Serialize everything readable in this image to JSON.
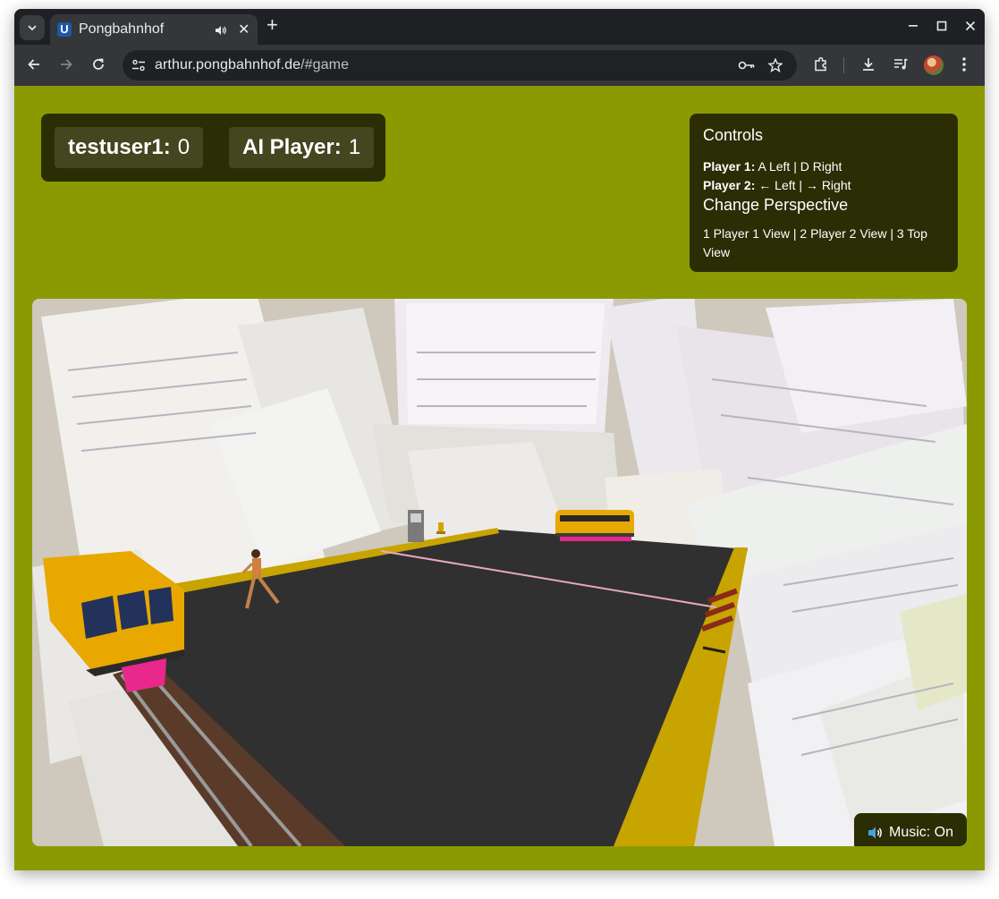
{
  "browser": {
    "tab_title": "Pongbahnhof",
    "favicon_letter": "U",
    "url_host": "arthur.pongbahnhof.de",
    "url_path": "/#game"
  },
  "scoreboard": {
    "player1_name": "testuser1:",
    "player1_score": "0",
    "player2_name": "AI Player:",
    "player2_score": "1"
  },
  "controls": {
    "title": "Controls",
    "p1_label": "Player 1:",
    "p1_keys": "A Left | D Right",
    "p2_label": "Player 2:",
    "p2_keys": "← Left | → Right",
    "perspective_title": "Change Perspective",
    "perspective_keys": "1 Player 1 View | 2 Player 2 View | 3 Top View"
  },
  "music": {
    "icon": "speaker-icon",
    "label": "Music: On"
  },
  "colors": {
    "page_bg": "#8b9a00",
    "panel_bg": "#2b2d04",
    "score_chip_bg": "#44461f",
    "court": "#303030",
    "court_edge": "#c8a400",
    "train_body": "#e8a800",
    "bumper": "#e8288a"
  }
}
